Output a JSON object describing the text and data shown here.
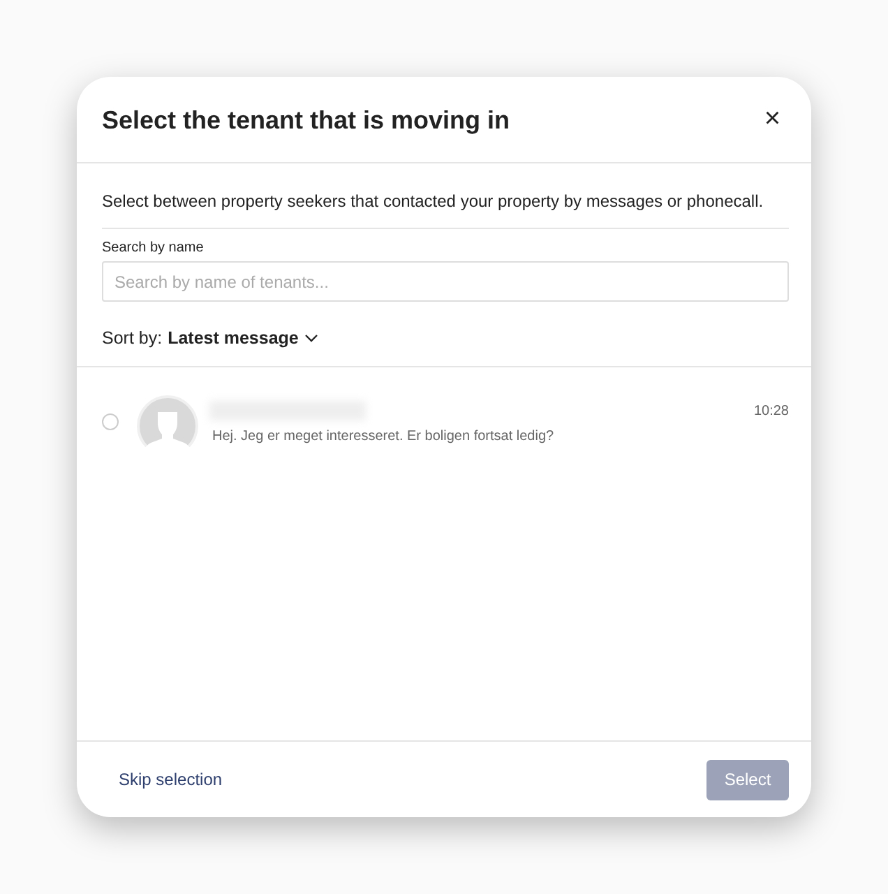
{
  "dialog": {
    "title": "Select the tenant that is moving in",
    "close": "×"
  },
  "description": "Select between property seekers that contacted your property by messages or phonecall.",
  "search": {
    "label": "Search by name",
    "placeholder": "Search by name of tenants..."
  },
  "sort": {
    "label": "Sort by:",
    "value": "Latest message"
  },
  "tenants": [
    {
      "selected": false,
      "message": "Hej. Jeg er meget interesseret. Er boligen fortsat ledig?",
      "time": "10:28"
    }
  ],
  "footer": {
    "skip": "Skip selection",
    "select": {
      "label": "Select",
      "disabled": true
    }
  }
}
